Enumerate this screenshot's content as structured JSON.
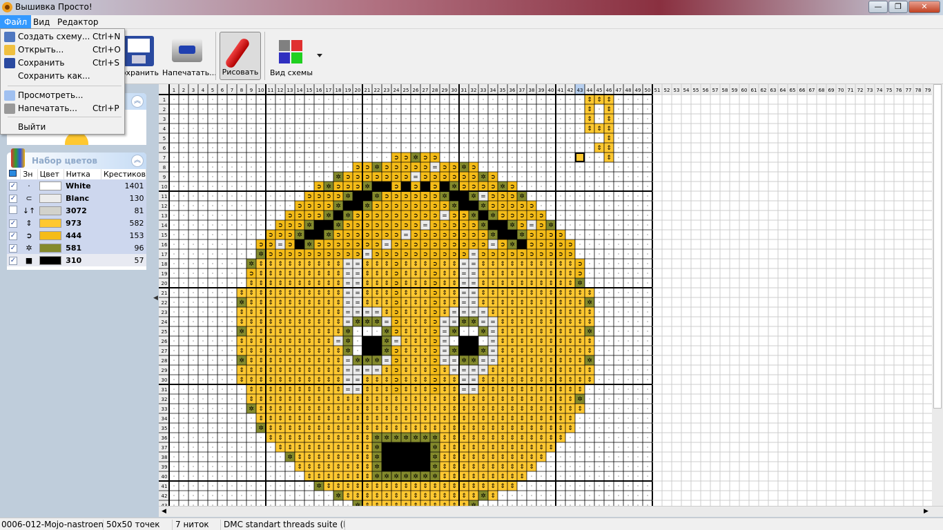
{
  "window": {
    "title": "Вышивка Просто!",
    "controls": [
      "—",
      "❐",
      "✕"
    ]
  },
  "menubar": [
    {
      "label": "Файл",
      "active": true
    },
    {
      "label": "Вид"
    },
    {
      "label": "Редактор"
    }
  ],
  "file_menu": [
    {
      "label": "Создать схему...",
      "shortcut": "Ctrl+N",
      "icon": "new-scheme-icon"
    },
    {
      "label": "Открыть...",
      "shortcut": "Ctrl+O",
      "icon": "open-folder-icon"
    },
    {
      "label": "Сохранить",
      "shortcut": "Ctrl+S",
      "icon": "floppy-icon"
    },
    {
      "label": "Сохранить как...",
      "shortcut": ""
    },
    {
      "label": "Просмотреть...",
      "shortcut": "",
      "icon": "preview-icon"
    },
    {
      "label": "Напечатать...",
      "shortcut": "Ctrl+P",
      "icon": "printer-icon"
    },
    {
      "label": "Выйти",
      "shortcut": ""
    }
  ],
  "toolbar": {
    "save": "Сохранить",
    "print": "Напечатать...",
    "draw": "Рисовать",
    "view": "Вид схемы"
  },
  "palette": {
    "title": "Набор цветов",
    "headers": [
      "Зн",
      "Цвет",
      "Нитка",
      "Крестиков"
    ],
    "items": [
      {
        "checked": true,
        "symbol": "·",
        "color": "#ffffff",
        "thread": "White",
        "count": "1401"
      },
      {
        "checked": true,
        "symbol": "⊂",
        "color": "#ececec",
        "thread": "Blanc",
        "count": "130"
      },
      {
        "checked": false,
        "symbol": "↓↑",
        "color": "#d2d2cc",
        "thread": "3072",
        "count": "81"
      },
      {
        "checked": true,
        "symbol": "⇕",
        "color": "#ffc830",
        "thread": "973",
        "count": "582"
      },
      {
        "checked": true,
        "symbol": "➲",
        "color": "#f5bc18",
        "thread": "444",
        "count": "153"
      },
      {
        "checked": true,
        "symbol": "✲",
        "color": "#848a2c",
        "thread": "581",
        "count": "96"
      },
      {
        "checked": true,
        "symbol": "■",
        "color": "#000000",
        "thread": "310",
        "count": "57",
        "selected": true
      }
    ]
  },
  "grid": {
    "columns": 79,
    "pattern_columns": 50,
    "rows_visible": 42,
    "highlight_column": 43
  },
  "status": {
    "file": "0006-012-Mojo-nastroenie",
    "size": "50x50 точек",
    "threads": "7 ниток",
    "suite": "DMC standart threads suite (France)"
  }
}
